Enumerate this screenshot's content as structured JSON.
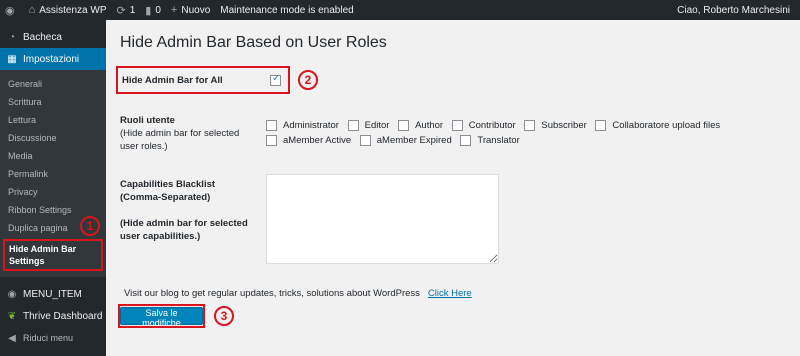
{
  "admin_bar": {
    "site_name": "Assistenza WP",
    "updates_count": "1",
    "comments_count": "0",
    "new_label": "Nuovo",
    "maintenance_text": "Maintenance mode is enabled",
    "greeting": "Ciao, Roberto Marchesini"
  },
  "sidebar": {
    "dashboard": "Bacheca",
    "settings": "Impostazioni",
    "submenu": [
      "Generali",
      "Scrittura",
      "Lettura",
      "Discussione",
      "Media",
      "Permalink",
      "Privacy",
      "Ribbon Settings",
      "Duplica pagina"
    ],
    "current_submenu": "Hide Admin Bar Settings",
    "menu_item": "MENU_ITEM",
    "thrive": "Thrive Dashboard",
    "collapse": "Riduci menu"
  },
  "page": {
    "title": "Hide Admin Bar Based on User Roles",
    "hide_all_label": "Hide Admin Bar for All",
    "hide_all_checked": true,
    "roles_label": "Ruoli utente",
    "roles_desc": "(Hide admin bar for selected user roles.)",
    "roles": [
      "Administrator",
      "Editor",
      "Author",
      "Contributor",
      "Subscriber",
      "Collaboratore upload files",
      "aMember Active",
      "aMember Expired",
      "Translator"
    ],
    "cap_label": "Capabilities Blacklist",
    "cap_sub": "(Comma-Separated)",
    "cap_desc": "(Hide admin bar for selected user capabilities.)",
    "cap_value": "",
    "blog_text": "Visit our blog to get regular updates, tricks, solutions about WordPress",
    "blog_link": "Click Here",
    "save_label": "Salva le modifiche"
  },
  "callouts": [
    "1",
    "2",
    "3"
  ],
  "colors": {
    "admin_bg": "#23282d",
    "accent": "#0073aa",
    "highlight": "#d9141e"
  }
}
